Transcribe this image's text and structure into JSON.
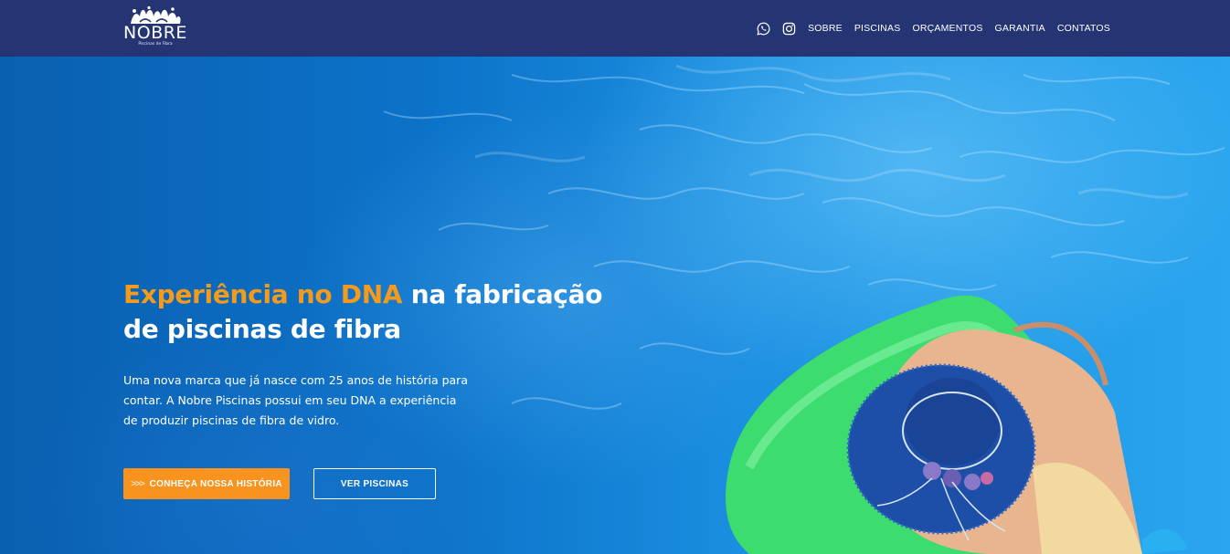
{
  "header": {
    "logo": {
      "wordmark": "NOBRE",
      "tagline": "Piscinas de Fibra"
    },
    "social": [
      {
        "icon": "whatsapp-icon"
      },
      {
        "icon": "instagram-icon"
      }
    ],
    "nav": [
      "SOBRE",
      "PISCINAS",
      "ORÇAMENTOS",
      "GARANTIA",
      "CONTATOS"
    ]
  },
  "hero": {
    "title_accent": "Experiência no DNA",
    "title_rest": " na fabricação de piscinas de fibra",
    "description": "Uma nova marca que já nasce com 25 anos de história para contar. A Nobre Piscinas possui em seu DNA a experiência de produzir piscinas de fibra de vidro.",
    "primary_button": {
      "arrows": ">>>",
      "label": "CONHEÇA NOSSA HISTÓRIA"
    },
    "secondary_button": {
      "label": "VER PISCINAS"
    }
  },
  "colors": {
    "header_bg": "#253473",
    "accent": "#f59a1b",
    "button_primary": "#f7931e",
    "pool_blue": "#0c73c9",
    "float_green": "#3ddc6e",
    "hat_blue": "#1d4fa8"
  }
}
